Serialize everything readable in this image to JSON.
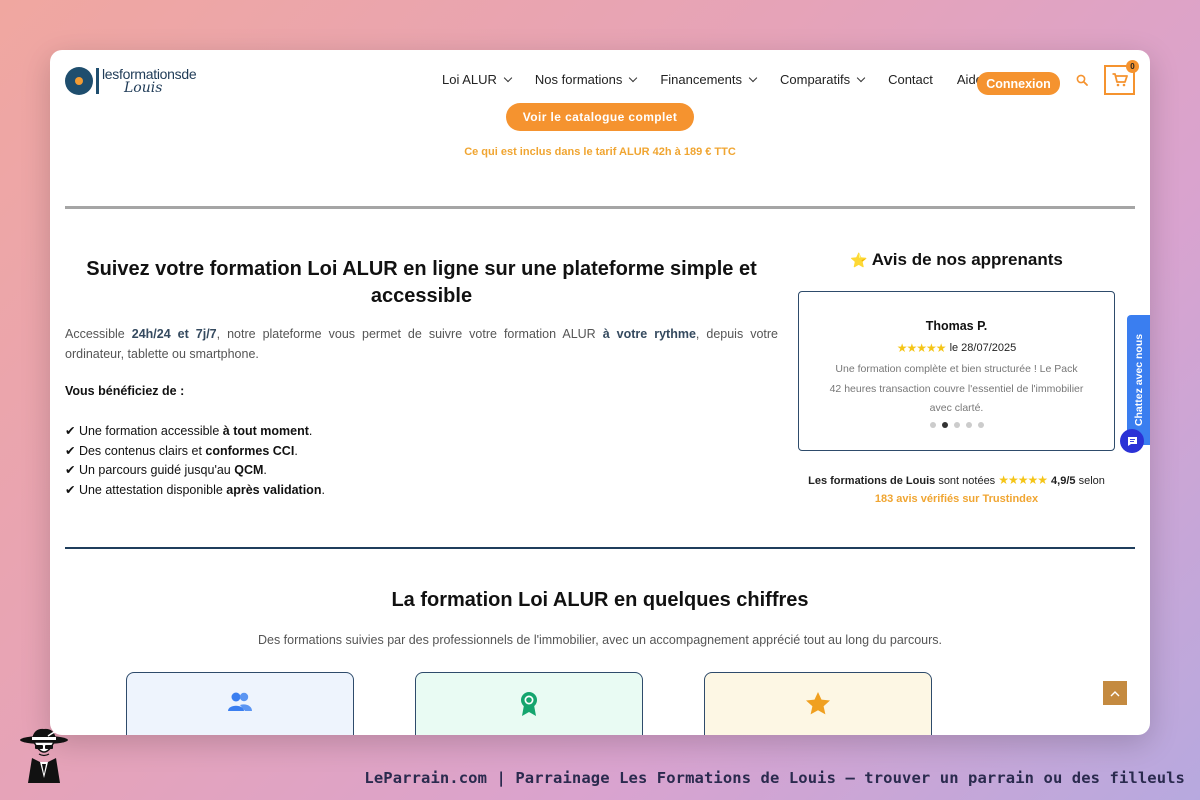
{
  "header": {
    "logo_top": "lesformationsde",
    "logo_bottom": "Louis",
    "nav": [
      {
        "label": "Loi ALUR",
        "has_dropdown": true
      },
      {
        "label": "Nos formations",
        "has_dropdown": true
      },
      {
        "label": "Financements",
        "has_dropdown": true
      },
      {
        "label": "Comparatifs",
        "has_dropdown": true
      },
      {
        "label": "Contact",
        "has_dropdown": false
      },
      {
        "label": "Aide",
        "has_dropdown": false
      }
    ],
    "login_label": "Connexion",
    "cart_count": "0"
  },
  "top": {
    "catalogue_button": "Voir le catalogue complet",
    "included_link": "Ce qui est inclus dans le tarif ALUR 42h à 189 € TTC"
  },
  "platform": {
    "title": "Suivez votre formation Loi ALUR en ligne sur une plateforme simple et accessible",
    "para_prefix": "Accessible ",
    "para_bold1": "24h/24 et 7j/7",
    "para_mid": ", notre plateforme vous permet de suivre votre formation ALUR ",
    "para_bold2": "à votre rythme",
    "para_suffix": ", depuis votre ordinateur, tablette ou smartphone.",
    "benefits_title": "Vous bénéficiez de :",
    "benefits": [
      {
        "prefix": "✔ Une formation accessible ",
        "bold": "à tout moment",
        "suffix": "."
      },
      {
        "prefix": "✔ Des contenus clairs et ",
        "bold": "conformes CCI",
        "suffix": "."
      },
      {
        "prefix": "✔ Un parcours guidé jusqu'au ",
        "bold": "QCM",
        "suffix": "."
      },
      {
        "prefix": "✔ Une attestation disponible ",
        "bold": "après validation",
        "suffix": "."
      }
    ]
  },
  "reviews": {
    "title_icon": "⭐",
    "title": "Avis de nos apprenants",
    "reviewer": "Thomas P.",
    "stars": "★★★★★",
    "date": "le 28/07/2025",
    "text": "Une formation complète et bien structurée ! Le Pack 42 heures transaction couvre l'essentiel de l'immobilier avec clarté.",
    "carousel_dots": 5,
    "active_dot": 1,
    "score_brand": "Les formations de Louis",
    "score_mid": "sont notées",
    "score_stars": "★★★★★",
    "score_value": "4,9/5",
    "score_suffix": "selon",
    "trustindex_link": "183 avis vérifiés sur Trustindex"
  },
  "chat": {
    "tab_label": "Chattez avec nous",
    "color": "#3a7ef0"
  },
  "chiffres": {
    "title": "La formation Loi ALUR en quelques chiffres",
    "subtitle": "Des formations suivies par des professionnels de l'immobilier, avec un accompagnement apprécié tout au long du parcours.",
    "cards": [
      {
        "icon": "users-icon",
        "bg": "#eef4fd"
      },
      {
        "icon": "award-icon",
        "bg": "#e9fbf3"
      },
      {
        "icon": "star-icon",
        "bg": "#fdf7e4"
      }
    ]
  },
  "footer": {
    "caption": "LeParrain.com | Parrainage Les Formations de Louis — trouver un parrain ou des filleuls"
  },
  "colors": {
    "accent_orange": "#f5932f",
    "link_orange": "#f0a531",
    "navy": "#1f3e5c"
  }
}
